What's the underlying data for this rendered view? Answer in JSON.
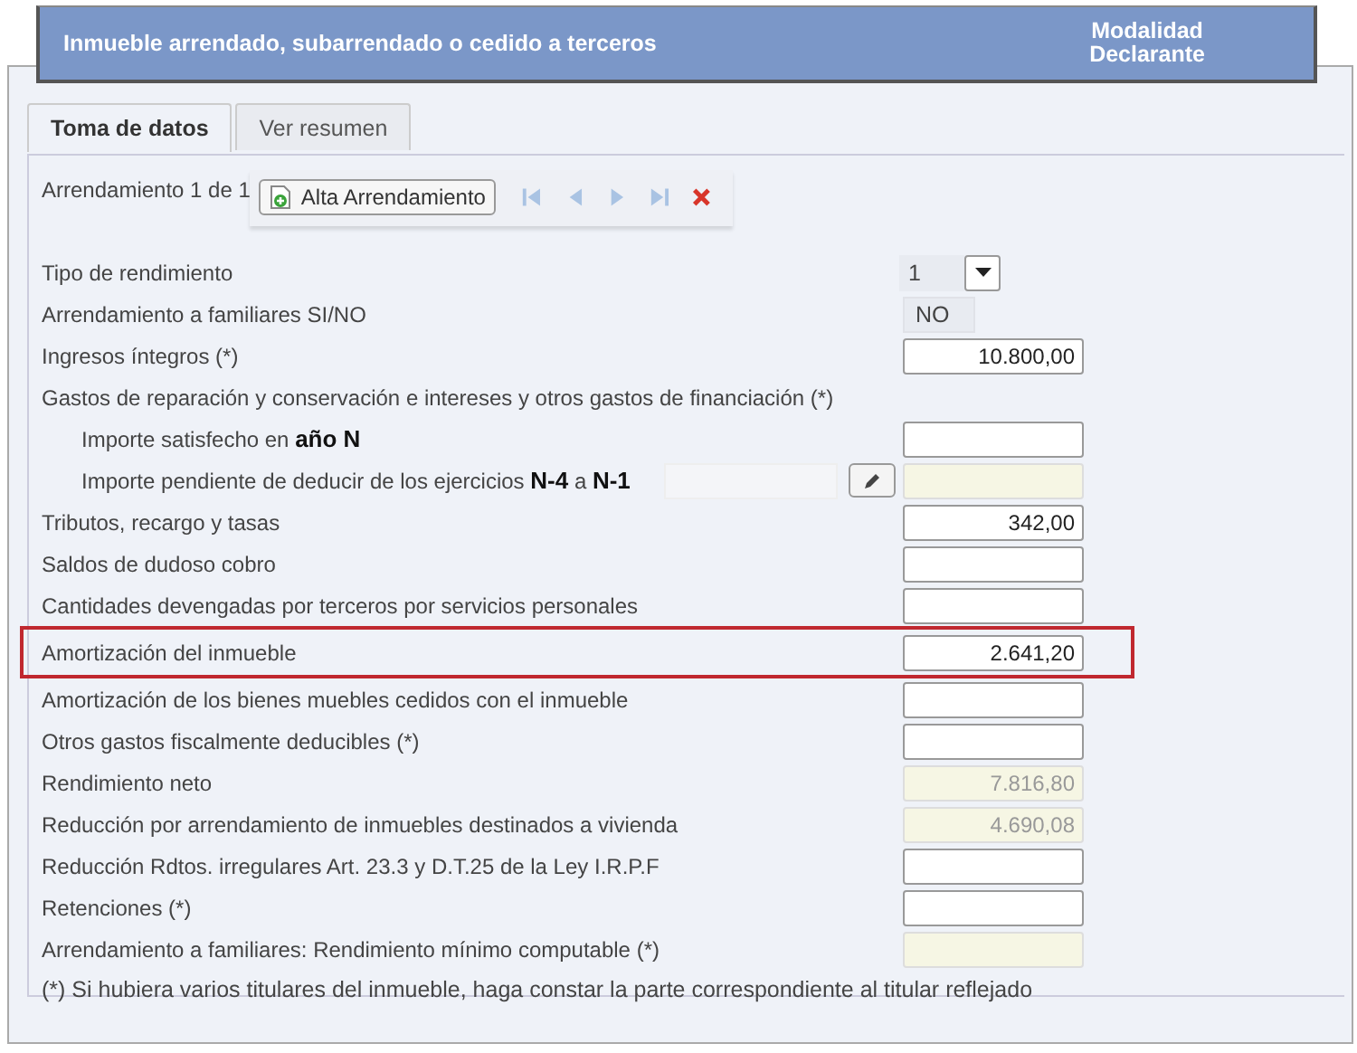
{
  "header": {
    "title": "Inmueble arrendado, subarrendado o cedido a terceros",
    "mode_lines": [
      "Modalidad",
      "Declarante"
    ]
  },
  "tabs": [
    {
      "label": "Toma de datos",
      "selected": true
    },
    {
      "label": "Ver resumen",
      "selected": false
    }
  ],
  "record": {
    "counter": "Arrendamiento 1 de 1",
    "add_button": "Alta Arrendamiento",
    "nav": [
      {
        "kind": "first",
        "disabled": true
      },
      {
        "kind": "prev",
        "disabled": true
      },
      {
        "kind": "next",
        "disabled": true
      },
      {
        "kind": "last",
        "disabled": true
      }
    ]
  },
  "rows": [
    {
      "label": "Tipo de rendimiento",
      "kind": "select",
      "value": "1",
      "highlighted": false
    },
    {
      "label": "Arrendamiento a familiares SI/NO",
      "kind": "readonly",
      "value": "NO",
      "highlighted": false
    },
    {
      "label": "Ingresos íntegros (*)",
      "kind": "input",
      "value": "10.800,00",
      "highlighted": false
    },
    {
      "label": "Gastos de reparación y conservación e intereses y otros gastos de financiación (*)",
      "kind": "heading",
      "highlighted": false,
      "children": [
        {
          "label": "Importe satisfecho en **año N**",
          "kind": "input"
        },
        {
          "label": "Importe pendiente de deducir de los ejercicios **N-4** a **N-1**",
          "kind": "split"
        }
      ]
    },
    {
      "label": "Tributos, recargo y tasas",
      "kind": "input",
      "value": "342,00",
      "highlighted": false
    },
    {
      "label": "Saldos de dudoso cobro",
      "kind": "input",
      "highlighted": false
    },
    {
      "label": "Cantidades devengadas por terceros por servicios personales",
      "kind": "input",
      "highlighted": false
    },
    {
      "label": "Amortización del inmueble",
      "kind": "input",
      "value": "2.641,20",
      "highlighted": true
    },
    {
      "label": "Amortización de los bienes muebles cedidos con el inmueble",
      "kind": "input",
      "highlighted": false
    },
    {
      "label": "Otros gastos fiscalmente deducibles (*)",
      "kind": "input",
      "highlighted": false
    },
    {
      "label": "Rendimiento neto",
      "kind": "computed",
      "value": "7.816,80",
      "highlighted": false
    },
    {
      "label": "Reducción por arrendamiento de inmuebles destinados a vivienda",
      "kind": "computed",
      "value": "4.690,08",
      "highlighted": false
    },
    {
      "label": "Reducción Rdtos. irregulares Art. 23.3 y D.T.25 de la Ley I.R.P.F",
      "kind": "input",
      "highlighted": false
    },
    {
      "label": "Retenciones (*)",
      "kind": "input",
      "highlighted": false
    },
    {
      "label": "Arrendamiento a familiares: Rendimiento mínimo computable (*)",
      "kind": "computed",
      "highlighted": false
    }
  ],
  "note": "(*) Si hubiera varios titulares del inmueble, haga constar la parte correspondiente al titular reflejado"
}
